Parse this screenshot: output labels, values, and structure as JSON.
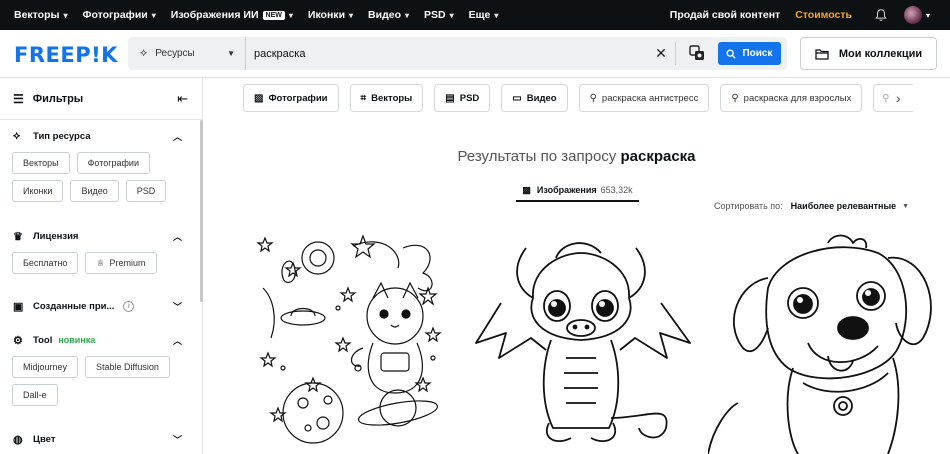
{
  "topnav": {
    "items": [
      {
        "label": "Векторы"
      },
      {
        "label": "Фотографии"
      },
      {
        "label": "Изображения ИИ",
        "badge": "NEW"
      },
      {
        "label": "Иконки"
      },
      {
        "label": "Видео"
      },
      {
        "label": "PSD"
      },
      {
        "label": "Еще"
      }
    ],
    "sell": "Продай свой контент",
    "pricing": "Стоимость"
  },
  "header": {
    "logo": "FREEP!K",
    "resource_select": "Ресурсы",
    "search_value": "раскраска",
    "search_button": "Поиск",
    "collections": "Мои коллекции"
  },
  "sidebar": {
    "title": "Фильтры",
    "resource_type": {
      "title": "Тип ресурса",
      "chips": [
        "Векторы",
        "Фотографии",
        "Иконки",
        "Видео",
        "PSD"
      ]
    },
    "license": {
      "title": "Лицензия",
      "chips": [
        "Бесплатно",
        "Premium"
      ]
    },
    "saved": {
      "title": "Созданные при..."
    },
    "tool": {
      "title": "Tool",
      "new_label": "новинка",
      "chips": [
        "Midjourney",
        "Stable Diffusion",
        "Dall-e"
      ]
    },
    "color": {
      "title": "Цвет"
    }
  },
  "tags": {
    "photos": "Фотографии",
    "vectors": "Векторы",
    "psd": "PSD",
    "video": "Видео",
    "kw1": "раскраска антистресс",
    "kw2": "раскраска для взрослых"
  },
  "results": {
    "prefix": "Результаты по запросу",
    "query": "раскраска",
    "tab_label": "Изображения",
    "tab_count": "653,32k",
    "sort_label": "Сортировать по:",
    "sort_value": "Наиболее релевантные"
  },
  "colors": {
    "accent": "#1273eb",
    "topbar": "#0e1113",
    "pricing": "#f5a623",
    "new_green": "#2aa84a"
  }
}
